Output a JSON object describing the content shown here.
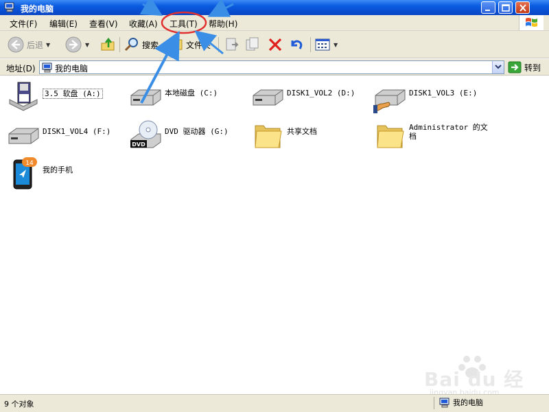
{
  "window": {
    "title": "我的电脑"
  },
  "menubar": {
    "items": [
      "文件(F)",
      "编辑(E)",
      "查看(V)",
      "收藏(A)",
      "工具(T)",
      "帮助(H)"
    ]
  },
  "toolbar": {
    "back_label": "后退",
    "search_label": "搜索",
    "folders_label": "文件夹"
  },
  "address": {
    "label": "地址(D)",
    "value": "我的电脑",
    "go_label": "转到"
  },
  "items": [
    {
      "label": "3.5 软盘 (A:)",
      "icon": "floppy-icon"
    },
    {
      "label": "本地磁盘 (C:)",
      "icon": "hard-drive-icon"
    },
    {
      "label": "DISK1_VOL2 (D:)",
      "icon": "hard-drive-icon"
    },
    {
      "label": "DISK1_VOL3 (E:)",
      "icon": "shared-drive-icon"
    },
    {
      "label": "DISK1_VOL4 (F:)",
      "icon": "hard-drive-icon"
    },
    {
      "label": "DVD 驱动器 (G:)",
      "icon": "dvd-drive-icon"
    },
    {
      "label": "共享文档",
      "icon": "folder-icon"
    },
    {
      "label": "Administrator 的文档",
      "icon": "folder-icon"
    },
    {
      "label": "我的手机",
      "icon": "phone-icon",
      "badge": "14"
    }
  ],
  "status": {
    "count_text": "9 个对象",
    "location_text": "我的电脑"
  },
  "watermark": {
    "brand": "Bai du 经验",
    "url": "jingyan.baidu.com"
  },
  "colors": {
    "titlebar": "#0a5be0",
    "chrome": "#ece9d8",
    "annotation_arrow": "#3a8ee6",
    "highlight_circle": "#e03030"
  }
}
